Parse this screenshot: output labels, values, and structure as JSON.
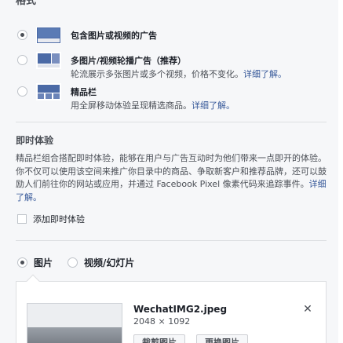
{
  "header": {
    "cut_title": "格式"
  },
  "formats": [
    {
      "title": "包含图片或视频的广告",
      "selected": true,
      "description": "",
      "link": ""
    },
    {
      "title": "多图片/视频轮播广告（推荐）",
      "selected": false,
      "description": "轮流展示多张图片或多个视频，价格不变化。",
      "link": "详细了解。"
    },
    {
      "title": "精品栏",
      "selected": false,
      "description": "用全屏移动体验呈现精选商品。",
      "link": "详细了解。"
    }
  ],
  "instant_experience": {
    "title": "即时体验",
    "description": "精品栏组合搭配即时体验，能够在用户与广告互动时为他们带来一点即开的体验。你不仅可以使用该空间来推广你目录中的商品、争取新客户和推荐品牌，还可以鼓励人们前往你的网站或应用，并通过 Facebook Pixel 像素代码来追踪事件。",
    "link": "详细了解。",
    "checkbox_label": "添加即时体验"
  },
  "media_type": {
    "options": [
      {
        "label": "图片",
        "selected": true
      },
      {
        "label": "视频/幻灯片",
        "selected": false
      }
    ]
  },
  "media_item": {
    "file_name": "WechatIMG2.jpeg",
    "dimensions": "2048 × 1092",
    "buttons": [
      "裁剪图片",
      "更换图片"
    ],
    "close_icon": "close-icon"
  },
  "colors": {
    "link": "#365899",
    "background": "#f6f7f9",
    "border": "#dddfe2"
  }
}
